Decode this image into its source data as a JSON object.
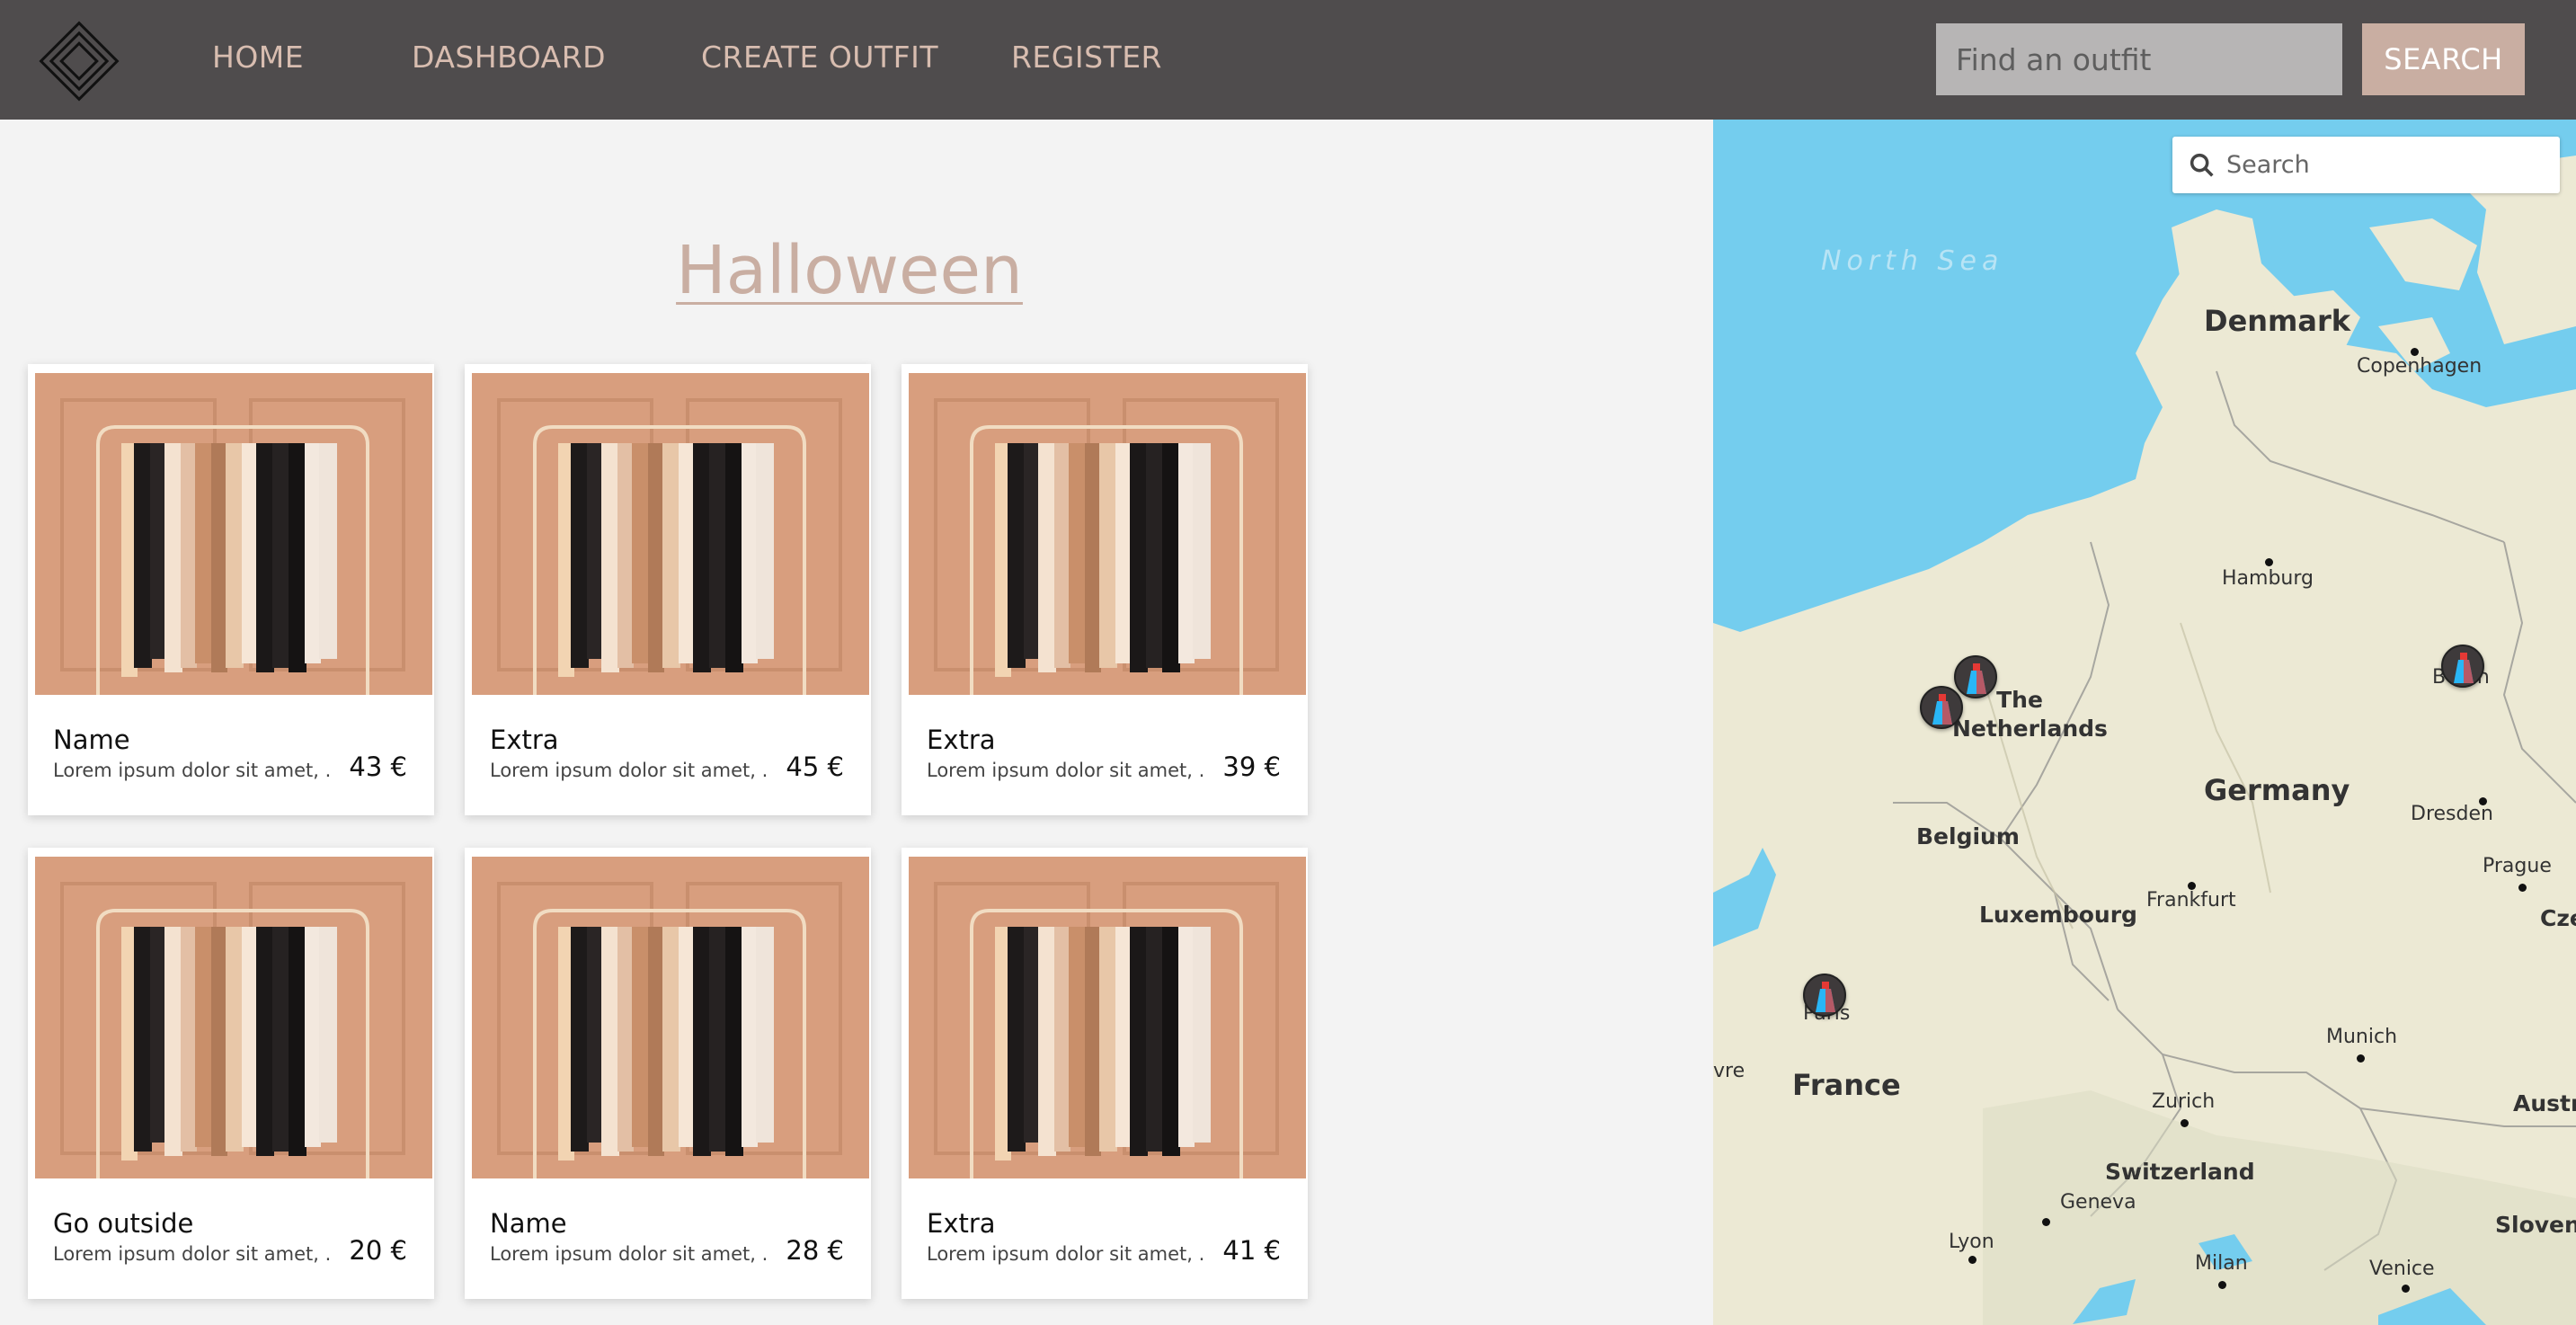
{
  "nav": {
    "logo": "logo-icon",
    "links": [
      "HOME",
      "DASHBOARD",
      "CREATE OUTFIT",
      "REGISTER"
    ],
    "search_placeholder": "Find an outfit",
    "search_button": "SEARCH"
  },
  "page": {
    "title": "Halloween"
  },
  "cards": [
    {
      "name": "Name",
      "description": "Lorem ipsum dolor sit amet, ...",
      "price": "43 €"
    },
    {
      "name": "Extra",
      "description": "Lorem ipsum dolor sit amet, ...",
      "price": "45 €"
    },
    {
      "name": "Extra",
      "description": "Lorem ipsum dolor sit amet, ...",
      "price": "39 €"
    },
    {
      "name": "Go outside",
      "description": "Lorem ipsum dolor sit amet, ...",
      "price": "20 €"
    },
    {
      "name": "Name",
      "description": "Lorem ipsum dolor sit amet, ...",
      "price": "28 €"
    },
    {
      "name": "Extra",
      "description": "Lorem ipsum dolor sit amet, ...",
      "price": "41 €"
    }
  ],
  "map": {
    "search_placeholder": "Search",
    "sea_label": "North Sea",
    "countries": [
      "Denmark",
      "Germany",
      "Belgium",
      "Luxembourg",
      "France",
      "Switzerland",
      "Austria",
      "Slovenia",
      "The Netherlands"
    ],
    "cities": [
      "Copenhagen",
      "Hamburg",
      "Berlin",
      "Dresden",
      "Prague",
      "Frankfurt",
      "Paris",
      "Munich",
      "Zurich",
      "Geneva",
      "Lyon",
      "Milan",
      "Venice",
      "Czec",
      "vre"
    ],
    "marker_icon": "dress-marker-icon",
    "colors": {
      "water": "#74cdee",
      "land": "#eeeed8"
    }
  },
  "theme": {
    "navbar": "#4f4c4d",
    "accent": "#c9aea2",
    "nav_text": "#d8bdb0",
    "page_bg": "#f3f3f3"
  }
}
